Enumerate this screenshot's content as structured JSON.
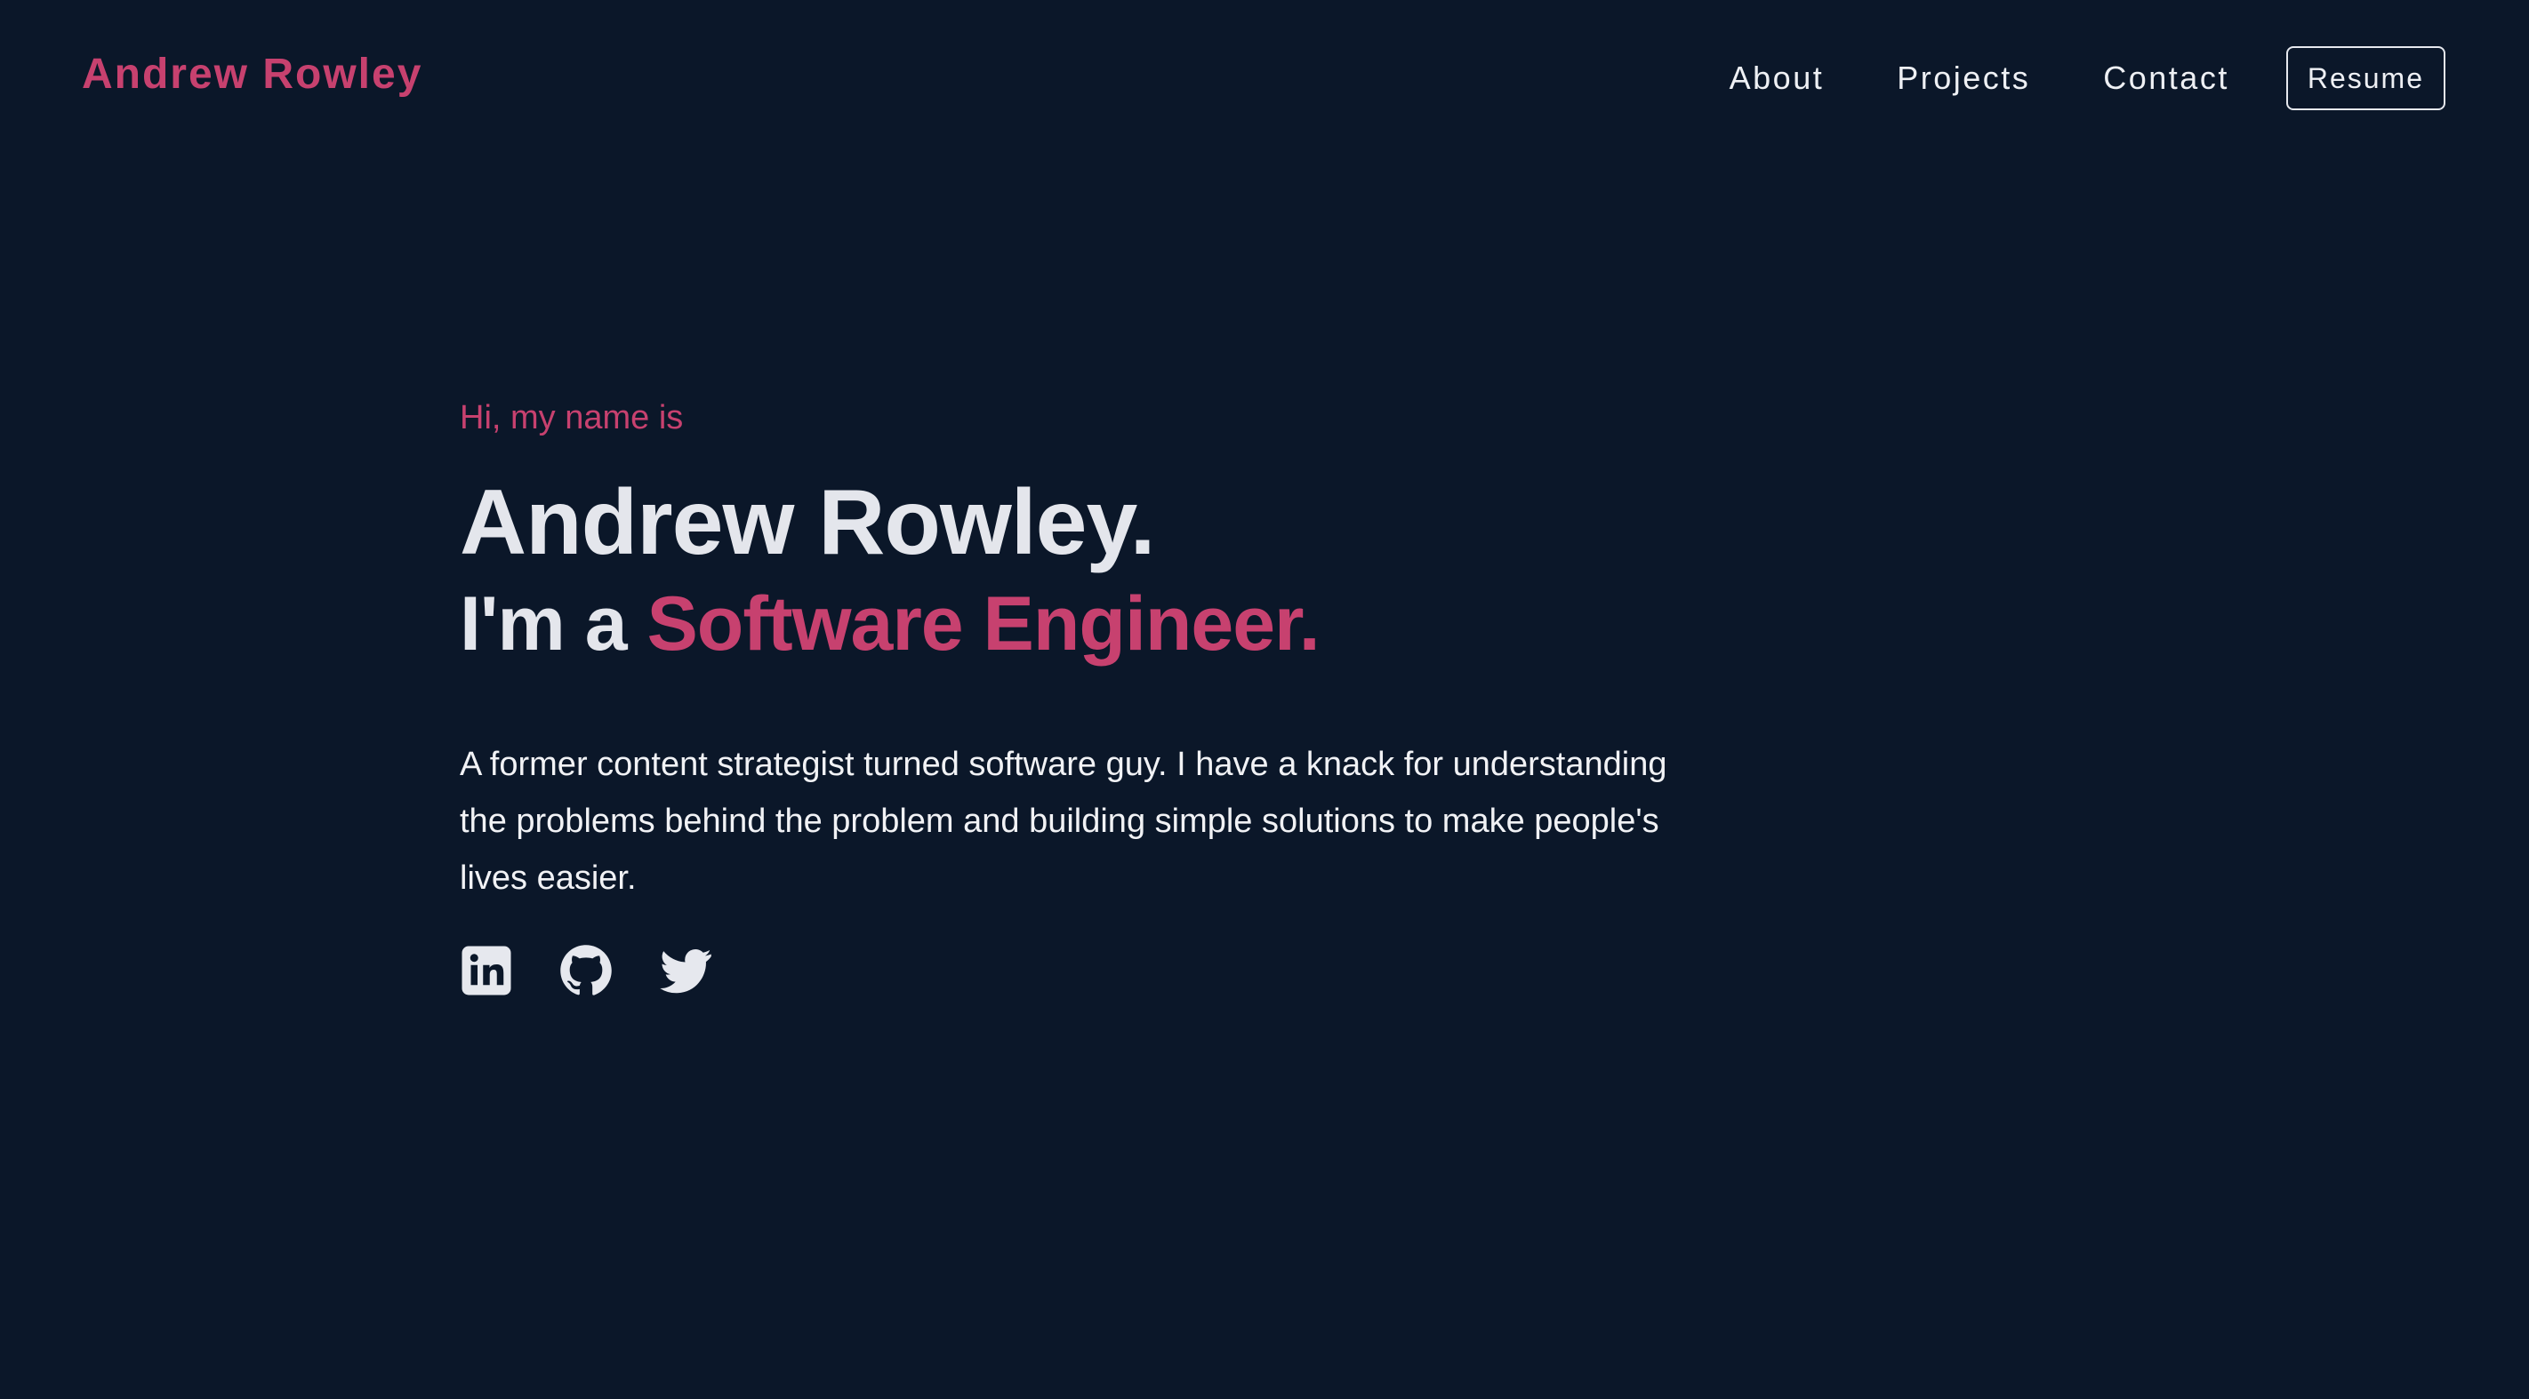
{
  "header": {
    "logo": "Andrew Rowley",
    "nav": [
      {
        "label": "About"
      },
      {
        "label": "Projects"
      },
      {
        "label": "Contact"
      }
    ],
    "resume_label": "Resume"
  },
  "hero": {
    "greeting": "Hi, my name is",
    "name": "Andrew Rowley.",
    "role_prefix": "I'm a ",
    "role_highlight": "Software Engineer.",
    "bio": "A former content strategist turned software guy. I have a knack for understanding the problems behind the problem and building simple solutions to make people's lives easier."
  },
  "social": [
    {
      "icon": "linkedin-icon"
    },
    {
      "icon": "github-icon"
    },
    {
      "icon": "twitter-icon"
    }
  ],
  "colors": {
    "background": "#0b1729",
    "accent": "#c7416f",
    "text": "#e6e8ee"
  }
}
